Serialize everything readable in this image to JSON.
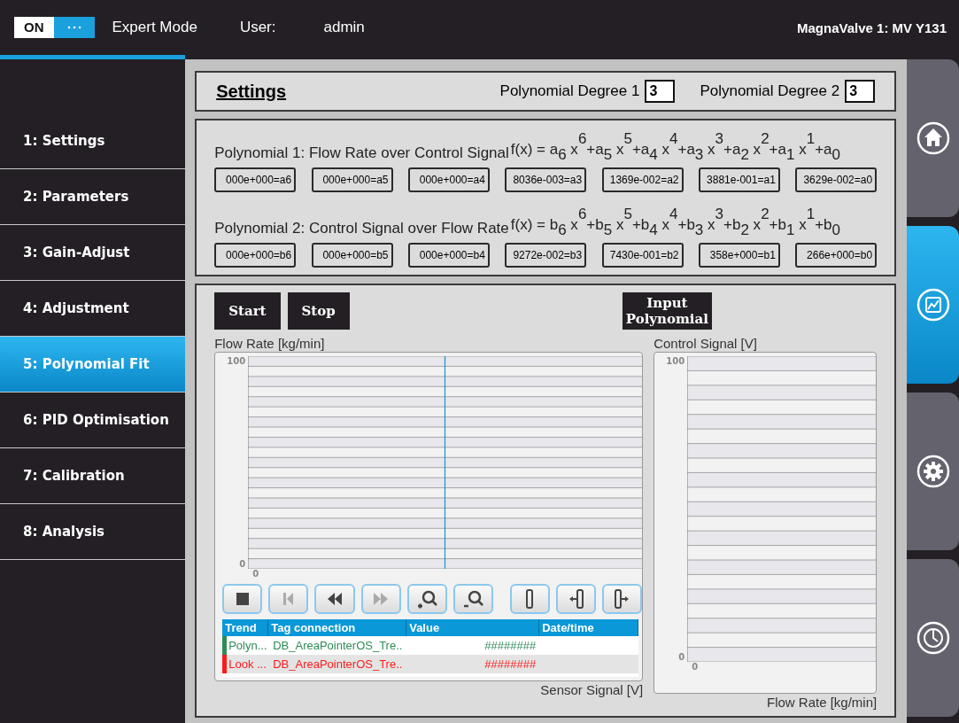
{
  "header": {
    "toggle": {
      "label": "ON",
      "on": true
    },
    "mode": "Expert Mode",
    "user_label": "User:",
    "user": "admin",
    "device": "MagnaValve 1: MV Y131"
  },
  "nav": [
    {
      "label": "1: Settings",
      "selected": false
    },
    {
      "label": "2: Parameters",
      "selected": false
    },
    {
      "label": "3: Gain-Adjust",
      "selected": false
    },
    {
      "label": "4: Adjustment",
      "selected": false
    },
    {
      "label": "5: Polynomial Fit",
      "selected": true
    },
    {
      "label": "6: PID Optimisation",
      "selected": false
    },
    {
      "label": "7: Calibration",
      "selected": false
    },
    {
      "label": "8: Analysis",
      "selected": false
    }
  ],
  "side_tabs": [
    {
      "kind": "home",
      "selected": false
    },
    {
      "kind": "trend",
      "selected": true
    },
    {
      "kind": "gear",
      "selected": false
    },
    {
      "kind": "clock",
      "selected": false
    }
  ],
  "settings": {
    "title": "Settings",
    "degree1_label": "Polynomial Degree 1",
    "degree1": "3",
    "degree2_label": "Polynomial Degree 2",
    "degree2": "3"
  },
  "polynomials": [
    {
      "title": "Polynomial 1: Flow Rate over Control Signal",
      "formula": "f(x) =  a$_{6}$ x$^{6}$+a$_{5}$ x$^{5}$+a$_{4}$ x$^{4}$+a$_{3}$ x$^{3}$+a$_{2}$ x$^{2}$+a$_{1}$ x$^{1}$+a$_{0}$",
      "coefficients": [
        "000e+000=a6",
        "000e+000=a5",
        "000e+000=a4",
        "8036e-003=a3",
        "1369e-002=a2",
        "3881e-001=a1",
        "3629e-002=a0"
      ]
    },
    {
      "title": "Polynomial 2: Control Signal over Flow Rate",
      "formula": "f(x) =  b$_{6}$ x$^{6}$+b$_{5}$ x$^{5}$+b$_{4}$ x$^{4}$+b$_{3}$ x$^{3}$+b$_{2}$ x$^{2}$+b$_{1}$ x$^{1}$+b$_{0}$",
      "coefficients": [
        "000e+000=b6",
        "000e+000=b5",
        "000e+000=b4",
        "9272e-002=b3",
        "7430e-001=b2",
        "358e+000=b1",
        "266e+000=b0"
      ]
    }
  ],
  "trend": {
    "buttons": [
      "Start",
      "Stop"
    ],
    "input_button": "Input\nPolynomial",
    "left_chart": {
      "ylabel": "Flow Rate [kg/min]",
      "y_max": "100",
      "y_min": "0",
      "x_min": "0",
      "xlabel": "Sensor Signal [V]"
    },
    "right_chart": {
      "ylabel": "Control Signal [V]",
      "y_max": "100",
      "y_min": "0",
      "x_min": "0",
      "xlabel": "Flow Rate [kg/min]"
    },
    "toolbar": [
      {
        "kind": "stop",
        "disabled": false
      },
      {
        "kind": "first",
        "disabled": true
      },
      {
        "kind": "back",
        "disabled": false
      },
      {
        "kind": "forward",
        "disabled": true
      },
      {
        "kind": "zoom-in",
        "disabled": false
      },
      {
        "kind": "zoom-out",
        "disabled": false
      },
      {
        "kind": "ruler",
        "disabled": false
      },
      {
        "kind": "ruler-left",
        "disabled": false
      },
      {
        "kind": "ruler-right",
        "disabled": false
      }
    ],
    "table": {
      "columns": [
        "Trend",
        "Tag connection",
        "Value",
        "Date/time"
      ],
      "rows": [
        {
          "trend": "Polyn...",
          "tag": "DB_AreaPointerOS_Tre..",
          "value": "########",
          "color": "#2e8b57",
          "selected": false
        },
        {
          "trend": "Look ...",
          "tag": "DB_AreaPointerOS_Tre..",
          "value": "########",
          "color": "#ff1a1a",
          "selected": true
        }
      ]
    }
  }
}
